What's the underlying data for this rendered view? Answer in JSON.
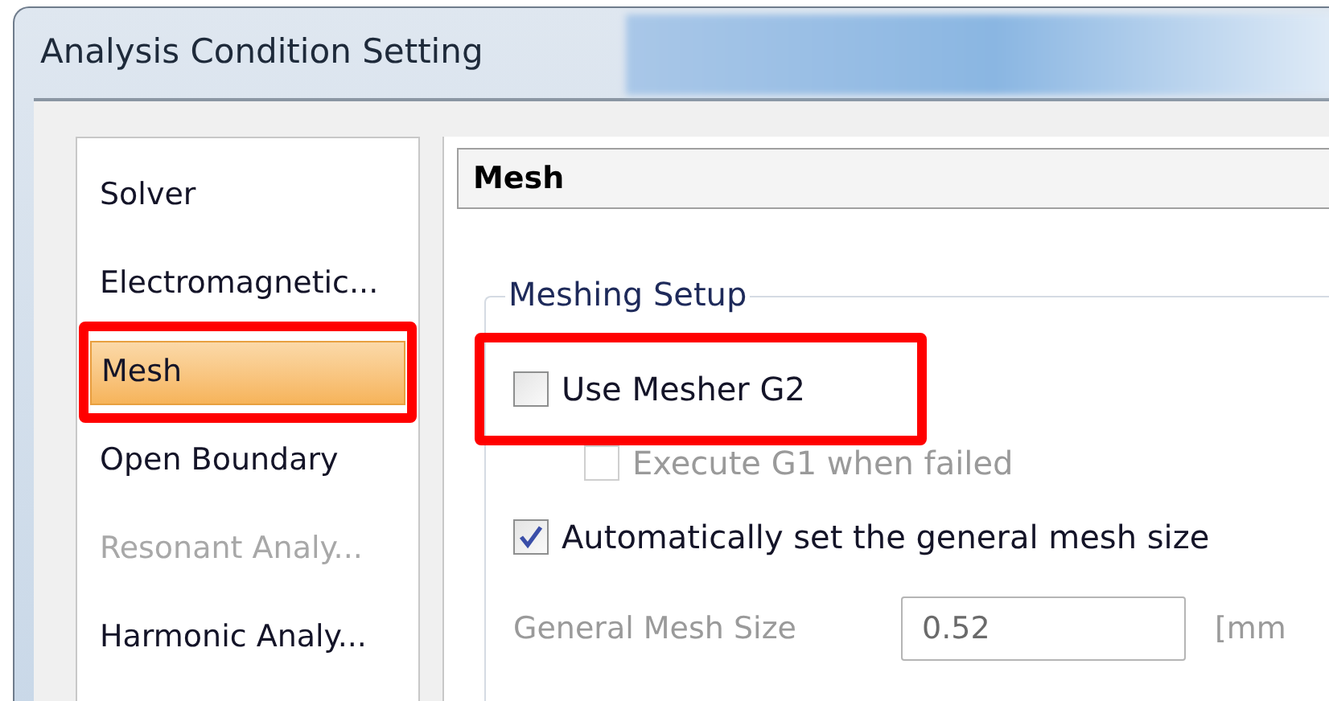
{
  "window": {
    "title": "Analysis Condition Setting"
  },
  "sidebar": {
    "items": [
      {
        "label": "Solver",
        "selected": false,
        "disabled": false,
        "highlighted": false
      },
      {
        "label": "Electromagnetic...",
        "selected": false,
        "disabled": false,
        "highlighted": false
      },
      {
        "label": "Mesh",
        "selected": true,
        "disabled": false,
        "highlighted": true
      },
      {
        "label": "Open Boundary",
        "selected": false,
        "disabled": false,
        "highlighted": false
      },
      {
        "label": "Resonant Analy...",
        "selected": false,
        "disabled": true,
        "highlighted": false
      },
      {
        "label": "Harmonic Analy...",
        "selected": false,
        "disabled": false,
        "highlighted": false
      }
    ]
  },
  "panel": {
    "title": "Mesh",
    "group": {
      "title": "Meshing Setup",
      "options": [
        {
          "kind": "checkbox",
          "label": "Use Mesher G2",
          "checked": false,
          "disabled": false,
          "indented": false,
          "highlighted": true
        },
        {
          "kind": "checkbox",
          "label": "Execute G1 when failed",
          "checked": false,
          "disabled": true,
          "indented": true,
          "highlighted": false
        },
        {
          "kind": "checkbox",
          "label": "Automatically set the general mesh size",
          "checked": true,
          "disabled": false,
          "indented": false,
          "highlighted": false
        },
        {
          "kind": "field",
          "label": "General Mesh Size",
          "value": "0.52",
          "unit": "[mm",
          "disabled": true,
          "highlighted": false
        }
      ]
    }
  }
}
